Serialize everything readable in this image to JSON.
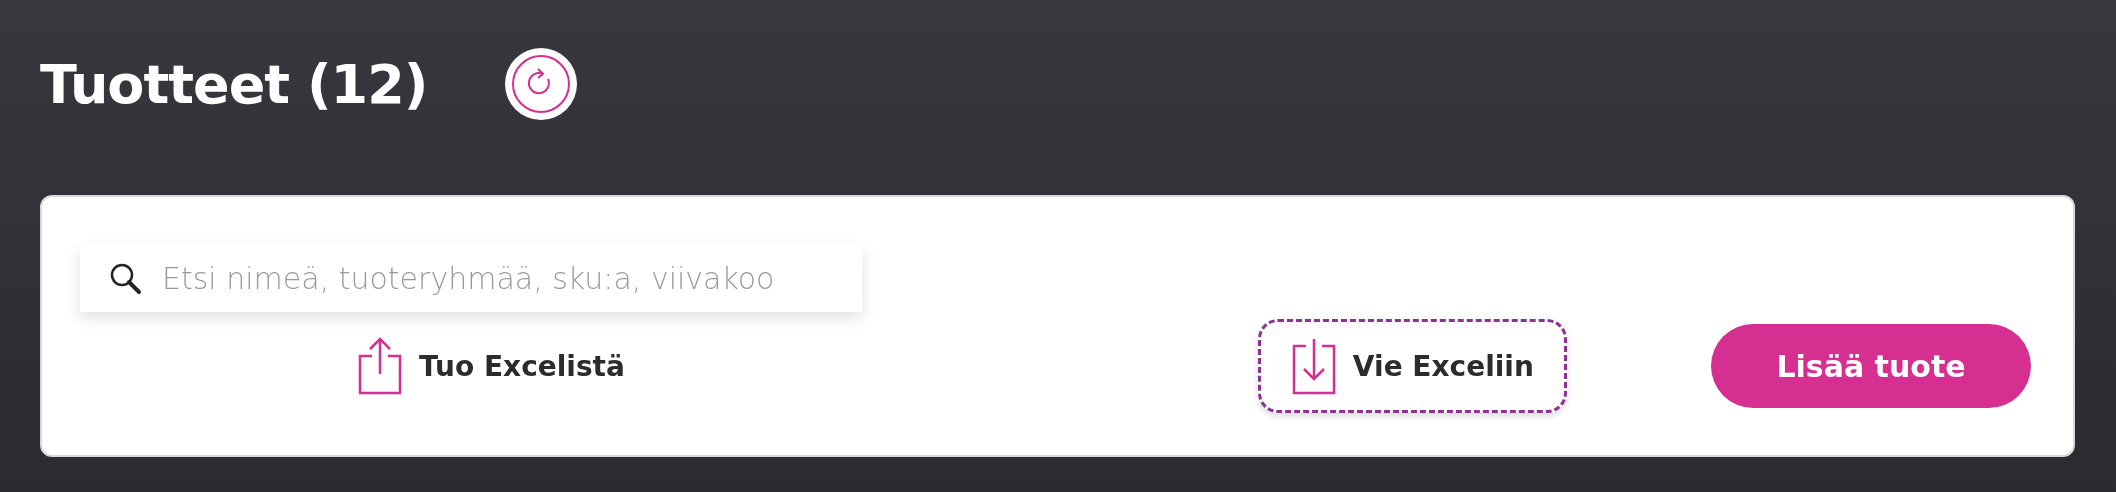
{
  "header": {
    "title": "Tuotteet (12)"
  },
  "toolbar": {
    "search": {
      "placeholder": "Etsi nimeä, tuoteryhmää, sku:a, viivakoo"
    },
    "actions": [
      {
        "kind": "import",
        "label": "Tuo Excelistä",
        "focused": false
      },
      {
        "kind": "export",
        "label": "Vie Exceliin",
        "focused": true
      }
    ],
    "add_button": "Lisää tuote"
  }
}
